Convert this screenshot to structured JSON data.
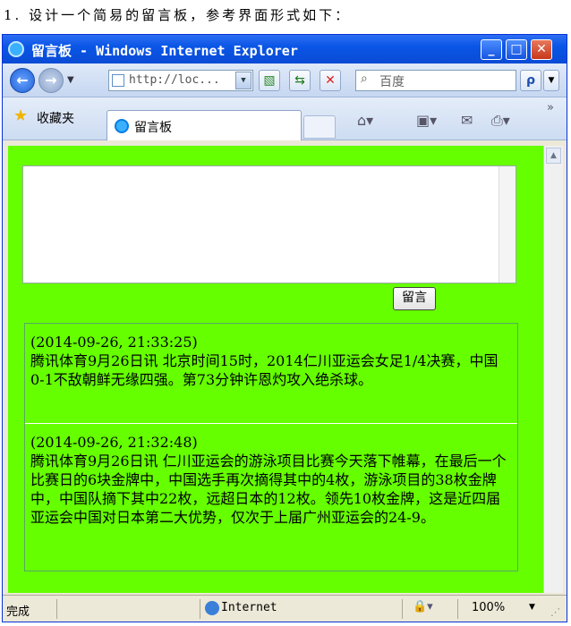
{
  "caption": "1. 设计一个简易的留言板，参考界面形式如下：",
  "window": {
    "title": "留言板 - Windows Internet Explorer",
    "minimize": "_",
    "maximize": "□",
    "close": "✕"
  },
  "nav": {
    "back": "←",
    "forward": "→",
    "address": "http://loc...",
    "address_dropdown": "▼",
    "search_placeholder": "百度",
    "search_button": "ρ"
  },
  "favorites": {
    "label": "收藏夹",
    "tab_title": "留言板"
  },
  "page": {
    "background": "#66ff00",
    "message_input": "",
    "submit_label": "留言",
    "messages": [
      {
        "timestamp": "(2014-09-26, 21:33:25)",
        "text": "腾讯体育9月26日讯 北京时间15时，2014仁川亚运会女足1/4决赛，中国0-1不敌朝鲜无缘四强。第73分钟许恩灼攻入绝杀球。"
      },
      {
        "timestamp": "(2014-09-26, 21:32:48)",
        "text": "腾讯体育9月26日讯 仁川亚运会的游泳项目比赛今天落下帷幕，在最后一个比赛日的6块金牌中，中国选手再次摘得其中的4枚，游泳项目的38枚金牌中，中国队摘下其中22枚，远超日本的12枚。领先10枚金牌，这是近四届亚运会中国对日本第二大优势，仅次于上届广州亚运会的24-9。"
      }
    ]
  },
  "status": {
    "text": "完成",
    "zone": "Internet",
    "zoom": "100%"
  }
}
